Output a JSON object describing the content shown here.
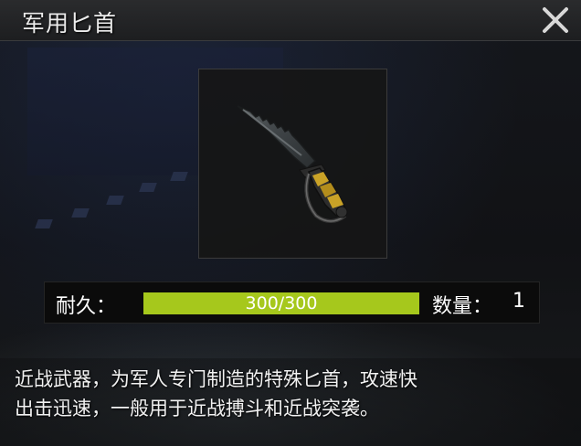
{
  "dialog": {
    "title": "军用匕首",
    "close_icon": "close-icon"
  },
  "item": {
    "icon": "combat-knife-icon",
    "durability_label": "耐久：",
    "durability_text": "300/300",
    "durability_fraction": 1.0,
    "quantity_label": "数量：",
    "quantity_value": "1"
  },
  "description": {
    "line1": "近战武器，为军人专门制造的特殊匕首，攻速快",
    "line2": "出击迅速，一般用于近战搏斗和近战突袭。"
  },
  "colors": {
    "durability_fill": "#a6c81c",
    "knife_grip_accent": "#c9a227"
  }
}
